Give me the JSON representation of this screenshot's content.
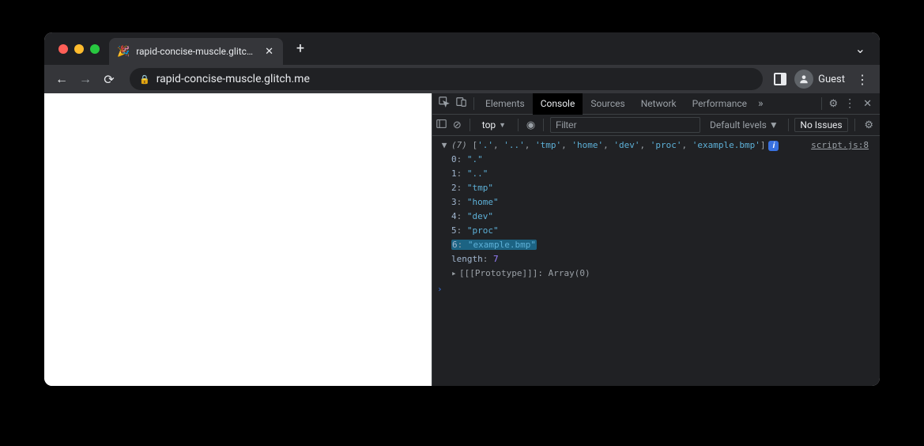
{
  "browser": {
    "tab_title": "rapid-concise-muscle.glitch.me",
    "tab_favicon": "🎉",
    "url": "rapid-concise-muscle.glitch.me",
    "profile_label": "Guest"
  },
  "devtools": {
    "tabs": [
      "Elements",
      "Console",
      "Sources",
      "Network",
      "Performance"
    ],
    "active_tab": "Console",
    "context": "top",
    "filter_placeholder": "Filter",
    "levels_label": "Default levels",
    "issues_label": "No Issues",
    "source_ref": "script.js:8",
    "array_length": 7,
    "array_summary_items": [
      "'.'",
      "'..'",
      "'tmp'",
      "'home'",
      "'dev'",
      "'proc'",
      "'example.bmp'"
    ],
    "entries": [
      {
        "k": "0",
        "v": "\".\""
      },
      {
        "k": "1",
        "v": "\"..\""
      },
      {
        "k": "2",
        "v": "\"tmp\""
      },
      {
        "k": "3",
        "v": "\"home\""
      },
      {
        "k": "4",
        "v": "\"dev\""
      },
      {
        "k": "5",
        "v": "\"proc\""
      },
      {
        "k": "6",
        "v": "\"example.bmp\"",
        "hl": true
      }
    ],
    "length_key": "length",
    "length_val": "7",
    "proto_label": "[[Prototype]]",
    "proto_val": "Array(0)"
  }
}
